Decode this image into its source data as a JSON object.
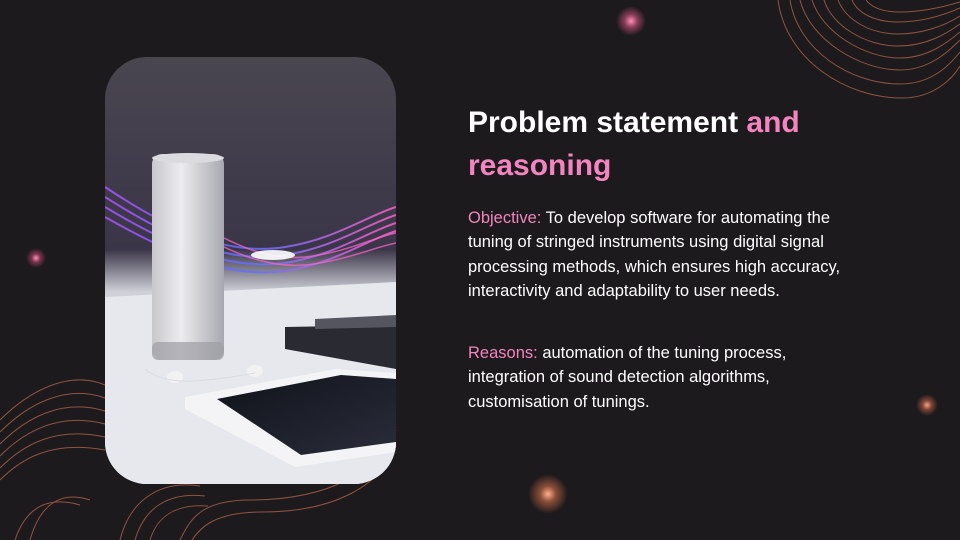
{
  "slide": {
    "title_white": "Problem statement",
    "title_accent": "and reasoning",
    "objective": {
      "label": "Objective:",
      "text": "To develop software for automating the tuning of stringed instruments using digital signal processing methods, which ensures high accuracy, interactivity and adaptability to user needs."
    },
    "reasons": {
      "label": "Reasons:",
      "text": "automation of the tuning process, integration of sound detection algorithms, customisation of tunings."
    }
  },
  "colors": {
    "background": "#1c1a1c",
    "accent": "#f285c0",
    "text": "#ffffff",
    "contour_lines": "#b8664e"
  },
  "image": {
    "description_icon": "speaker-photo"
  }
}
